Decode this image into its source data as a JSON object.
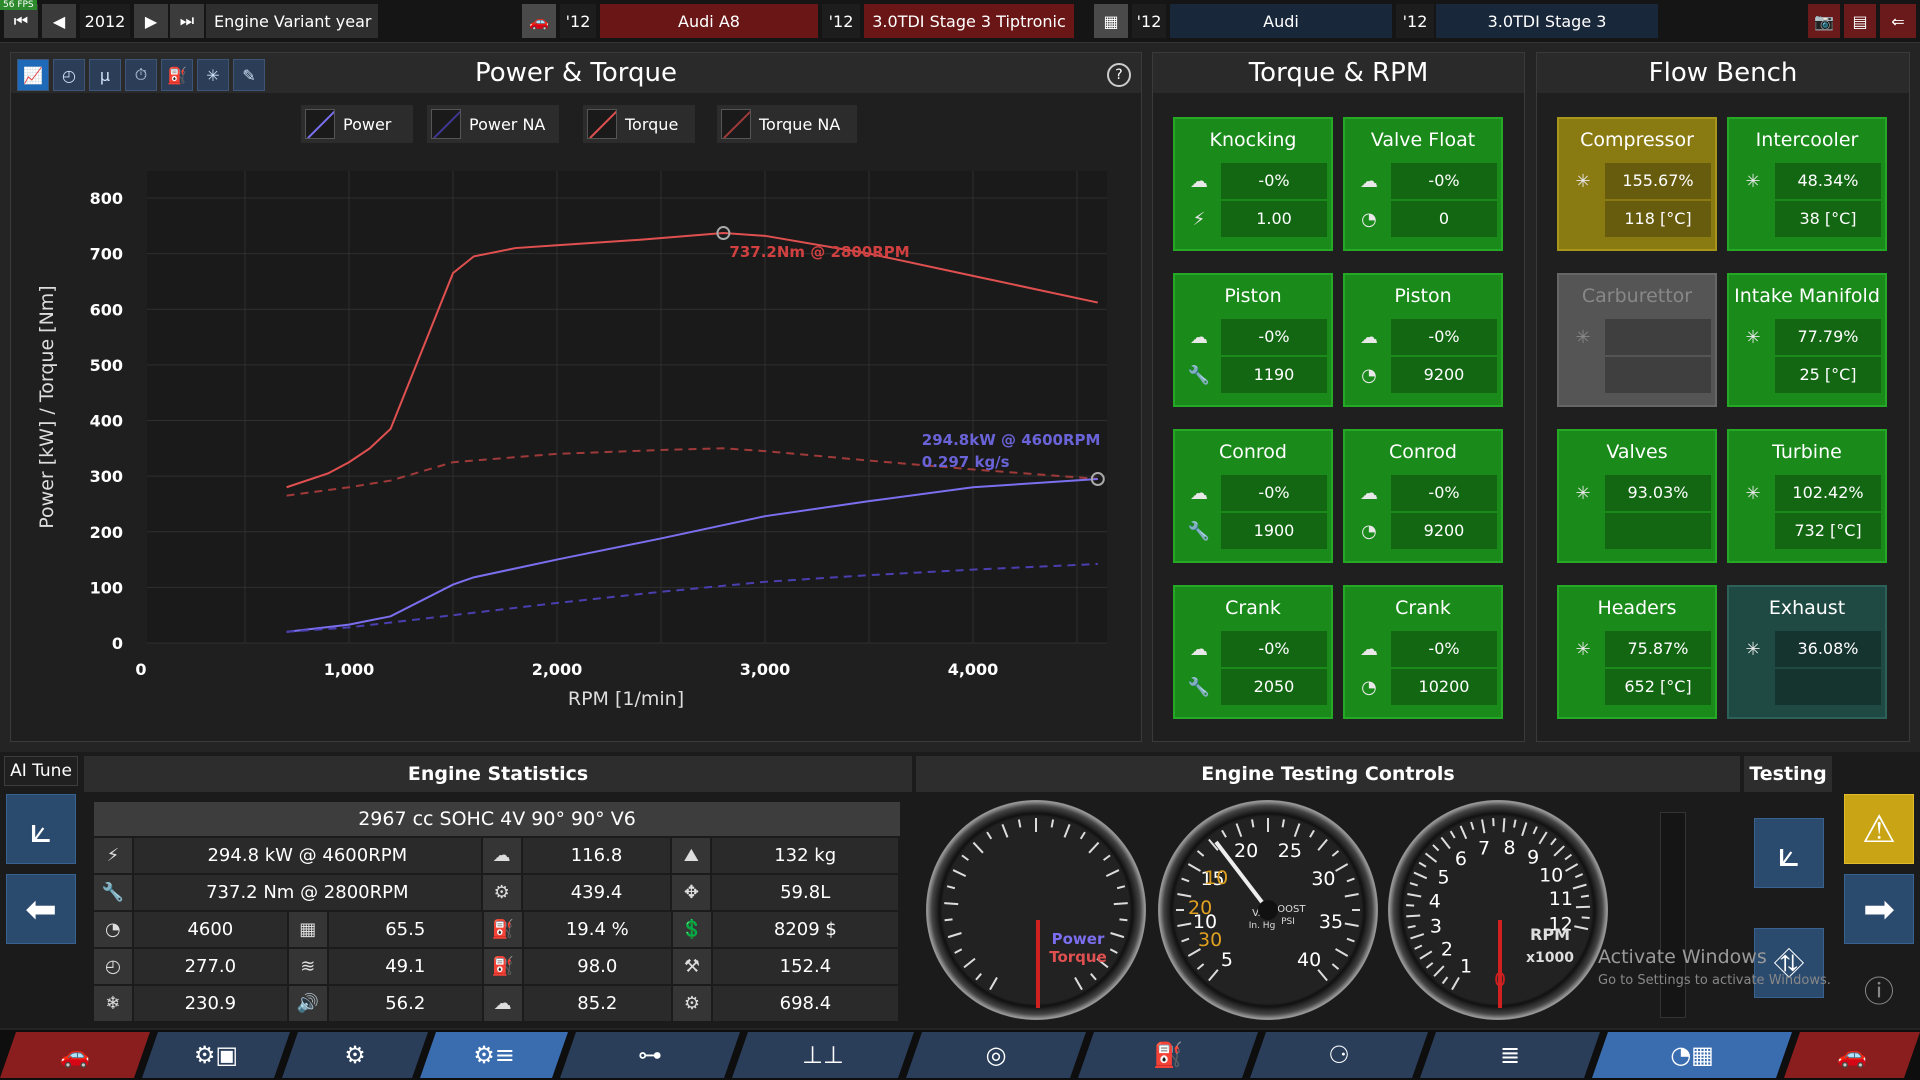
{
  "fps": "56 FPS",
  "topbar": {
    "year": "2012",
    "variant_label": "Engine Variant year",
    "car_year": "'12",
    "car_model": "Audi A8",
    "car_trim_year": "'12",
    "car_trim": "3.0TDI Stage 3 Tiptronic",
    "family_year": "'12",
    "family": "Audi",
    "variant_year": "'12",
    "variant": "3.0TDI Stage 3"
  },
  "power_panel": {
    "title": "Power & Torque",
    "legend": [
      "Power",
      "Power NA",
      "Torque",
      "Torque NA"
    ],
    "colors": {
      "power": "#7b6ff0",
      "power_na": "#4a3fb0",
      "torque": "#e05050",
      "torque_na": "#a03a3a"
    },
    "annotations": {
      "torque": "737.2Nm @ 2800RPM",
      "power": "294.8kW @ 4600RPM",
      "flow": "0.297 kg/s"
    }
  },
  "chart_data": {
    "type": "line",
    "xlabel": "RPM [1/min]",
    "ylabel": "Power [kW] / Torque [Nm]",
    "xlim": [
      0,
      4600
    ],
    "ylim": [
      0,
      800
    ],
    "xticks": [
      "0",
      "1,000",
      "2,000",
      "3,000",
      "4,000"
    ],
    "xtick_values": [
      0,
      1000,
      2000,
      3000,
      4000
    ],
    "yticks": [
      "0",
      "100",
      "200",
      "300",
      "400",
      "500",
      "600",
      "700",
      "800"
    ],
    "ytick_values": [
      0,
      100,
      200,
      300,
      400,
      500,
      600,
      700,
      800
    ],
    "series": [
      {
        "name": "Torque",
        "x": [
          700,
          900,
          1000,
          1100,
          1200,
          1500,
          1600,
          1800,
          2000,
          2400,
          2800,
          3000,
          3500,
          4000,
          4600
        ],
        "y": [
          280,
          305,
          325,
          350,
          385,
          665,
          695,
          710,
          715,
          725,
          737,
          732,
          700,
          660,
          612
        ]
      },
      {
        "name": "Torque NA",
        "x": [
          700,
          1000,
          1200,
          1500,
          2000,
          2500,
          2800,
          3000,
          3500,
          4000,
          4600
        ],
        "y": [
          265,
          280,
          292,
          325,
          340,
          347,
          350,
          345,
          328,
          312,
          295
        ]
      },
      {
        "name": "Power",
        "x": [
          700,
          1000,
          1200,
          1500,
          1600,
          2000,
          2500,
          3000,
          3500,
          4000,
          4600
        ],
        "y": [
          20,
          33,
          48,
          105,
          118,
          150,
          188,
          228,
          255,
          280,
          294.8
        ]
      },
      {
        "name": "Power NA",
        "x": [
          700,
          1000,
          1500,
          2000,
          2500,
          3000,
          3500,
          4000,
          4600
        ],
        "y": [
          20,
          28,
          50,
          72,
          92,
          110,
          122,
          132,
          142
        ]
      }
    ]
  },
  "torque_panel": {
    "title": "Torque & RPM",
    "blocks": [
      {
        "title": "Knocking",
        "v1": "-0%",
        "v2": "1.00",
        "i1": "☁",
        "i2": "⚡"
      },
      {
        "title": "Valve Float",
        "v1": "-0%",
        "v2": "0",
        "i1": "☁",
        "i2": "◔"
      },
      {
        "title": "Piston",
        "v1": "-0%",
        "v2": "1190",
        "i1": "☁",
        "i2": "🔧"
      },
      {
        "title": "Piston",
        "v1": "-0%",
        "v2": "9200",
        "i1": "☁",
        "i2": "◔"
      },
      {
        "title": "Conrod",
        "v1": "-0%",
        "v2": "1900",
        "i1": "☁",
        "i2": "🔧"
      },
      {
        "title": "Conrod",
        "v1": "-0%",
        "v2": "9200",
        "i1": "☁",
        "i2": "◔"
      },
      {
        "title": "Crank",
        "v1": "-0%",
        "v2": "2050",
        "i1": "☁",
        "i2": "🔧"
      },
      {
        "title": "Crank",
        "v1": "-0%",
        "v2": "10200",
        "i1": "☁",
        "i2": "◔"
      }
    ]
  },
  "flow_panel": {
    "title": "Flow Bench",
    "blocks": [
      {
        "title": "Compressor",
        "v1": "155.67%",
        "v2": "118 [°C]"
      },
      {
        "title": "Intercooler",
        "v1": "48.34%",
        "v2": "38 [°C]"
      },
      {
        "title": "Carburettor",
        "v1": "",
        "v2": ""
      },
      {
        "title": "Intake Manifold",
        "v1": "77.79%",
        "v2": "25 [°C]"
      },
      {
        "title": "Valves",
        "v1": "93.03%",
        "v2": ""
      },
      {
        "title": "Turbine",
        "v1": "102.42%",
        "v2": "732 [°C]"
      },
      {
        "title": "Headers",
        "v1": "75.87%",
        "v2": "652 [°C]"
      },
      {
        "title": "Exhaust",
        "v1": "36.08%",
        "v2": ""
      }
    ]
  },
  "bottom": {
    "ai_tune": "AI Tune",
    "stats_title": "Engine Statistics",
    "controls_title": "Engine Testing Controls",
    "testing_title": "Testing",
    "engine_desc": "2967 cc SOHC 4V 90° 90° V6",
    "stats": [
      [
        "294.8 kW @ 4600RPM",
        "116.8",
        "132 kg"
      ],
      [
        "737.2 Nm @ 2800RPM",
        "439.4",
        "59.8L"
      ],
      [
        "4600",
        "65.5",
        "19.4 %",
        "8209 $"
      ],
      [
        "277.0",
        "49.1",
        "98.0",
        "152.4"
      ],
      [
        "230.9",
        "56.2",
        "85.2",
        "698.4"
      ]
    ],
    "gauge1": {
      "l1": "Power",
      "l2": "Torque"
    },
    "gauge2": {
      "vac": "VAC",
      "vac_unit": "In. Hg",
      "boost": "BOOST",
      "boost_unit": "PSI",
      "nums_vac": [
        "10",
        "20",
        "30"
      ],
      "nums_boost": [
        "5",
        "10",
        "15",
        "20",
        "25",
        "30",
        "35",
        "40"
      ]
    },
    "gauge3": {
      "label": "RPM",
      "unit": "x1000",
      "nums": [
        "1",
        "2",
        "3",
        "4",
        "5",
        "6",
        "7",
        "8",
        "9",
        "10",
        "11",
        "12",
        "0"
      ]
    }
  },
  "watermark": {
    "line1": "Activate Windows",
    "line2": "Go to Settings to activate Windows."
  }
}
